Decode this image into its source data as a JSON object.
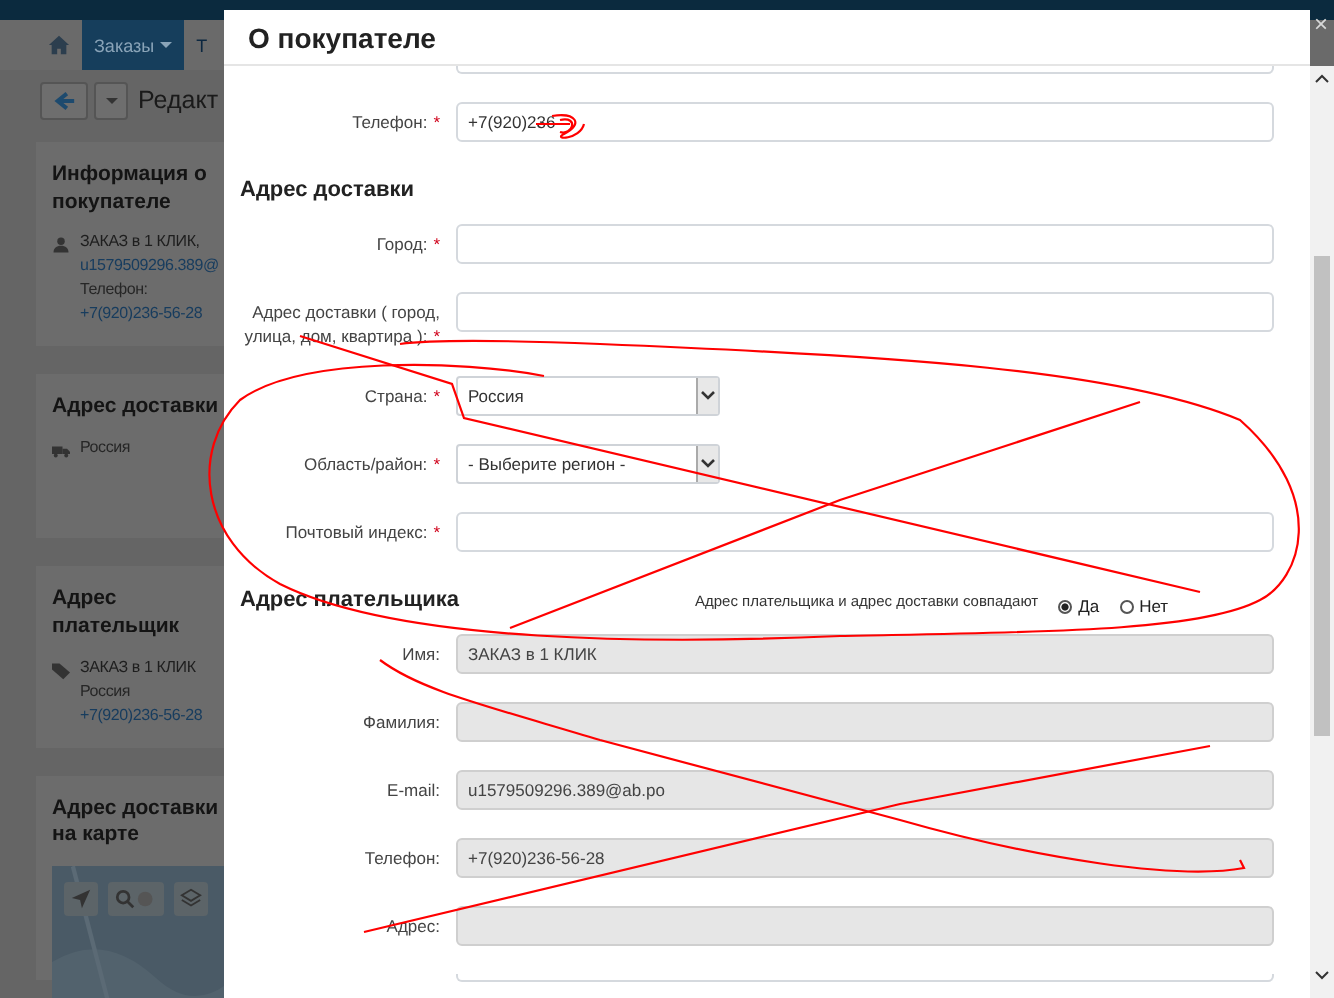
{
  "nav": {
    "tabs": [
      {
        "kind": "home",
        "selected": false
      },
      {
        "kind": "menu",
        "label": "Заказы",
        "selected": true
      },
      {
        "kind": "text",
        "label": "Т",
        "selected": false
      }
    ]
  },
  "toolbar": {
    "title": "Редакт"
  },
  "cards": [
    {
      "kind": "person",
      "title": "Информация о покупателе",
      "lines": [
        {
          "kind": "text",
          "text": "ЗАКАЗ в 1 КЛИК,"
        },
        {
          "kind": "link",
          "text": "u1579509296.389@"
        },
        {
          "kind": "muted",
          "text": "Телефон:"
        },
        {
          "kind": "link",
          "text": "+7(920)236-56-28"
        }
      ]
    },
    {
      "kind": "truck",
      "title": "Адрес доставки",
      "lines": [
        {
          "kind": "muted",
          "text": "Россия"
        }
      ]
    },
    {
      "kind": "tag",
      "title": "Адрес плательщик",
      "lines": [
        {
          "kind": "text",
          "text": "ЗАКАЗ в 1 КЛИК"
        },
        {
          "kind": "muted",
          "text": "Россия"
        },
        {
          "kind": "link",
          "text": "+7(920)236-56-28"
        }
      ]
    },
    {
      "kind": "map",
      "title": "Адрес доставки на карте"
    }
  ],
  "modal": {
    "title": "О покупателе",
    "close": "×",
    "fields": [
      {
        "kind": "stub"
      },
      {
        "kind": "input",
        "label": "Телефон:",
        "required_mark": "*",
        "value": "+7(920)236",
        "disabled": false
      },
      {
        "kind": "heading",
        "text": "Адрес доставки"
      },
      {
        "kind": "input",
        "label": "Город:",
        "required_mark": "*",
        "disabled": false
      },
      {
        "kind": "input",
        "label": "Адрес доставки ( город, улица, дом, квартира ):",
        "required_mark": "*",
        "disabled": false
      },
      {
        "kind": "select",
        "label": "Страна:",
        "required_mark": "*",
        "value": "Россия"
      },
      {
        "kind": "select",
        "label": "Область/район:",
        "required_mark": "*",
        "value": "- Выберите регион -"
      },
      {
        "kind": "input",
        "label": "Почтовый индекс:",
        "required_mark": "*",
        "disabled": false
      },
      {
        "kind": "radio-heading",
        "text": "Адрес плательщика",
        "question": "Адрес плательщика и адрес доставки совпадают",
        "options": [
          {
            "label": "Да",
            "selected": true
          },
          {
            "label": "Нет",
            "selected": false
          }
        ]
      },
      {
        "kind": "input",
        "label": "Имя:",
        "value": "ЗАКАЗ в 1 КЛИК",
        "disabled": true
      },
      {
        "kind": "input",
        "label": "Фамилия:",
        "disabled": true
      },
      {
        "kind": "input",
        "label": "E-mail:",
        "value": "u1579509296.389@ab.po",
        "disabled": true
      },
      {
        "kind": "input",
        "label": "Телефон:",
        "value": "+7(920)236-56-28",
        "disabled": true
      },
      {
        "kind": "input",
        "label": "Адрес:",
        "disabled": true
      },
      {
        "kind": "stub"
      }
    ]
  }
}
